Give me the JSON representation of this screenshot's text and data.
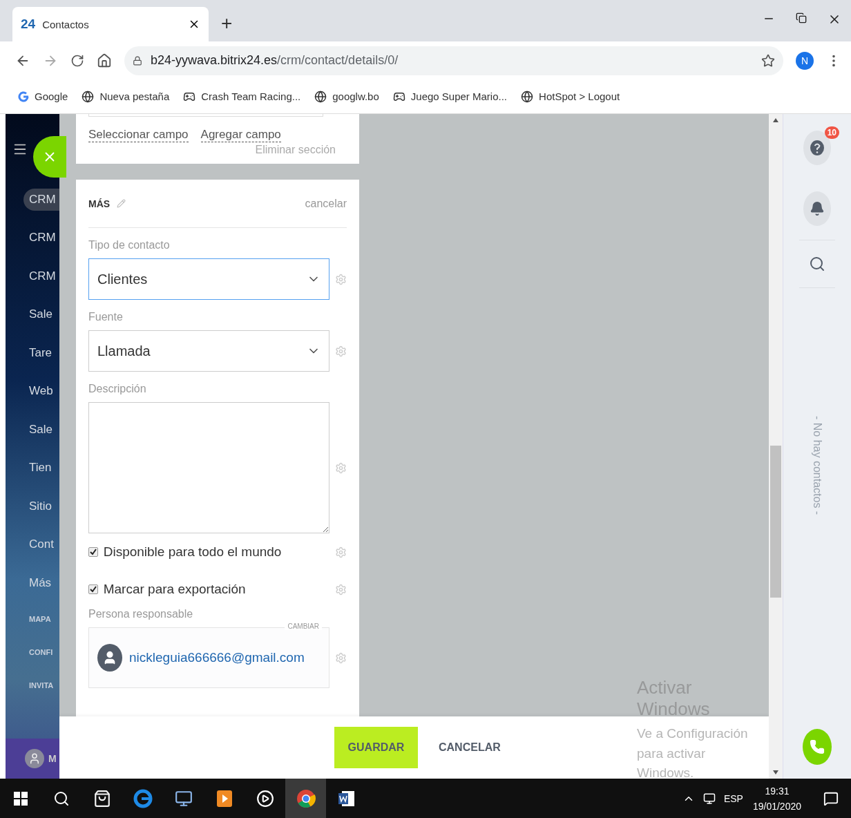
{
  "browser": {
    "tab": {
      "logo": "24",
      "title": "Contactos",
      "selected": true
    },
    "new_tab": "+",
    "url_host": "b24-yywava.bitrix24.es",
    "url_path": "/crm/contact/details/0/",
    "avatar": "N",
    "bookmarks": [
      {
        "kind": "google",
        "label": "Google"
      },
      {
        "kind": "globe",
        "label": "Nueva pestaña"
      },
      {
        "kind": "gamepad",
        "label": "Crash Team Racing..."
      },
      {
        "kind": "globe",
        "label": "googlw.bo"
      },
      {
        "kind": "gamepad",
        "label": "Juego Super Mario..."
      },
      {
        "kind": "globe",
        "label": "HotSpot > Logout"
      }
    ]
  },
  "sidebar": {
    "items": [
      {
        "label": "CRM",
        "selected": true,
        "kind": "main"
      },
      {
        "label": "CRM",
        "selected": false,
        "kind": "main"
      },
      {
        "label": "CRM",
        "selected": false,
        "kind": "main"
      },
      {
        "label": "Sale",
        "selected": false,
        "kind": "main"
      },
      {
        "label": "Tare",
        "selected": false,
        "kind": "main"
      },
      {
        "label": "Web",
        "selected": false,
        "kind": "main"
      },
      {
        "label": "Sale",
        "selected": false,
        "kind": "main"
      },
      {
        "label": "Tien",
        "selected": false,
        "kind": "main"
      },
      {
        "label": "Sitio",
        "selected": false,
        "kind": "main"
      },
      {
        "label": "Cont",
        "selected": false,
        "kind": "main"
      },
      {
        "label": "Más",
        "selected": false,
        "kind": "main"
      },
      {
        "label": "MAPA",
        "selected": false,
        "kind": "small"
      },
      {
        "label": "CONFI",
        "selected": false,
        "kind": "small"
      },
      {
        "label": "INVITA",
        "selected": false,
        "kind": "small"
      }
    ],
    "user_initial": "M"
  },
  "section_top": {
    "links": [
      "Seleccionar campo",
      "Agregar campo"
    ],
    "remove": "Eliminar sección"
  },
  "section": {
    "title": "MÁS",
    "cancel": "cancelar",
    "fields": [
      {
        "kind": "select",
        "label": "Tipo de contacto",
        "value": "Clientes",
        "focused": true
      },
      {
        "kind": "select",
        "label": "Fuente",
        "value": "Llamada",
        "focused": false
      },
      {
        "kind": "textarea",
        "label": "Descripción"
      },
      {
        "kind": "checkbox",
        "label": "Disponible para todo el mundo",
        "checked": true
      },
      {
        "kind": "checkbox",
        "label": "Marcar para exportación",
        "checked": true
      },
      {
        "kind": "user",
        "label": "Persona responsable",
        "change": "CAMBIAR",
        "value": "nickleguia666666@gmail.com"
      }
    ]
  },
  "footer": {
    "save": "GUARDAR",
    "cancel": "CANCELAR"
  },
  "right_panel": {
    "help_badge": "10",
    "empty_text": "- No hay contactos -"
  },
  "activation": {
    "title": "Activar Windows",
    "text": "Ve a Configuración para activar Windows."
  },
  "taskbar": {
    "language": "ESP",
    "time": "19:31",
    "date": "19/01/2020",
    "apps": [
      {
        "kind": "store",
        "selected": false
      },
      {
        "kind": "edge",
        "selected": false
      },
      {
        "kind": "computer",
        "selected": false
      },
      {
        "kind": "media",
        "selected": false
      },
      {
        "kind": "player",
        "selected": false
      },
      {
        "kind": "chrome",
        "selected": true
      },
      {
        "kind": "word",
        "selected": false
      }
    ]
  }
}
